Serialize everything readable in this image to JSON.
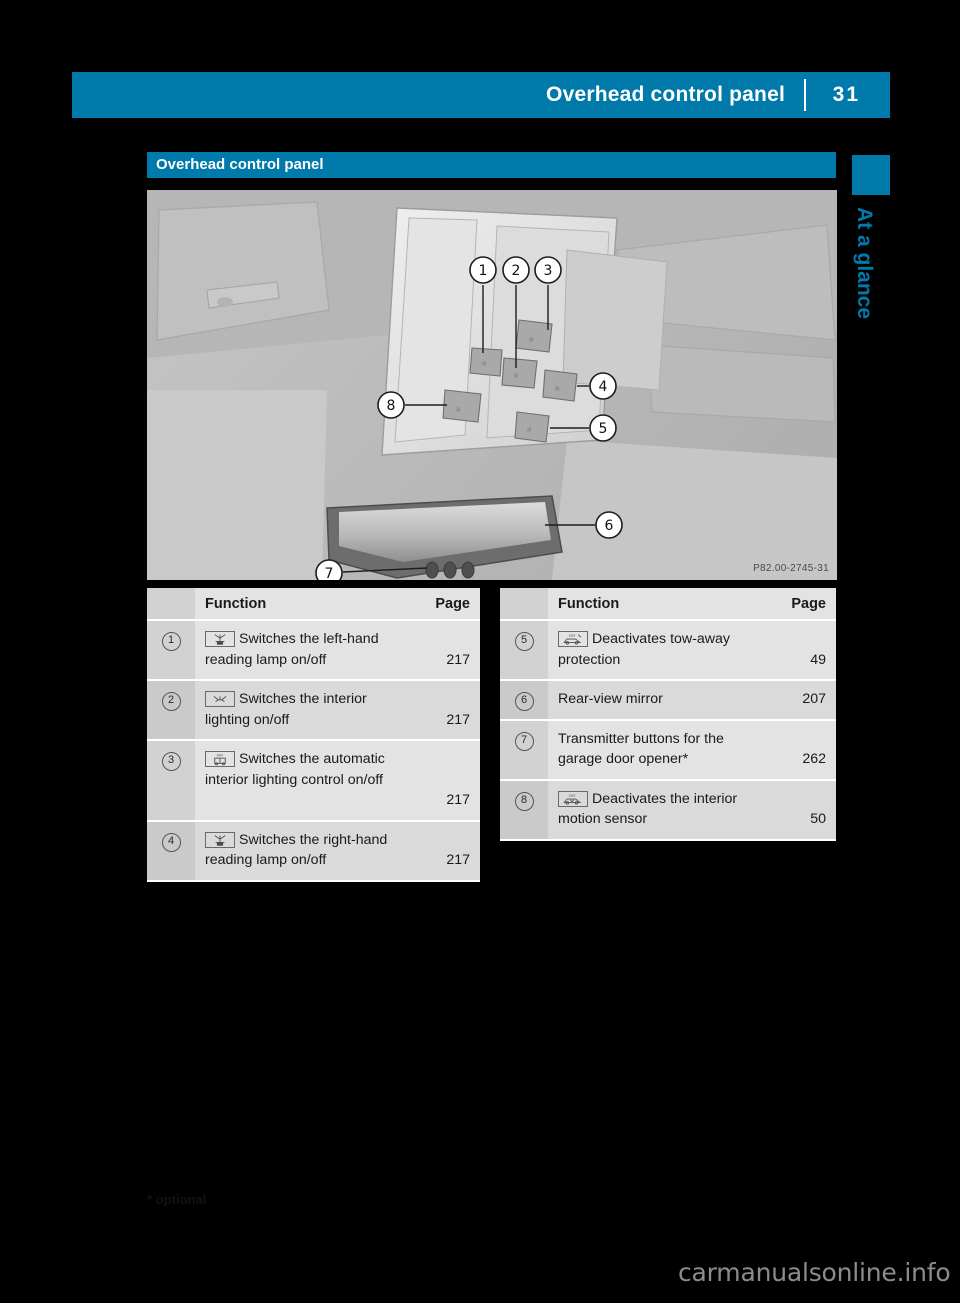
{
  "header": {
    "title": "Overhead control panel",
    "page_number": "31",
    "chapter": "At a glance"
  },
  "section": {
    "title": "Overhead control panel"
  },
  "figure": {
    "image_code": "P82.00-2745-31",
    "callouts": [
      "1",
      "2",
      "3",
      "4",
      "5",
      "6",
      "7",
      "8"
    ]
  },
  "tables": [
    {
      "id": "left",
      "columns": {
        "function": "Function",
        "page": "Page"
      },
      "rows": [
        {
          "num": "1",
          "icon": "reading-lamp-icon",
          "text": "Switches the left-hand reading lamp on/off",
          "page": "217"
        },
        {
          "num": "2",
          "icon": "interior-lighting-icon",
          "text": "Switches the interior lighting on/off",
          "page": "217"
        },
        {
          "num": "3",
          "icon": "automatic-interior-lighting-off-icon",
          "text": "Switches the automatic interior lighting control on/off",
          "page": "217"
        },
        {
          "num": "4",
          "icon": "reading-lamp-icon",
          "text": "Switches the right-hand reading lamp on/off",
          "page": "217"
        }
      ]
    },
    {
      "id": "right",
      "columns": {
        "function": "Function",
        "page": "Page"
      },
      "rows": [
        {
          "num": "5",
          "icon": "tow-away-protection-off-icon",
          "text": "Deactivates tow-away protection",
          "page": "49"
        },
        {
          "num": "6",
          "icon": "",
          "text": "Rear-view mirror",
          "page": "207"
        },
        {
          "num": "7",
          "icon": "",
          "text": "Transmitter buttons for the garage door opener*",
          "page": "262"
        },
        {
          "num": "8",
          "icon": "interior-motion-sensor-off-icon",
          "text": "Deactivates the interior motion sensor",
          "page": "50"
        }
      ]
    }
  ],
  "footnote": "* optional",
  "watermark": "carmanualsonline.info",
  "colors": {
    "accent": "#0079ab",
    "table_row": "#e3e3e3",
    "table_row_alt": "#dadada",
    "table_num_col": "#d2d2d2"
  }
}
